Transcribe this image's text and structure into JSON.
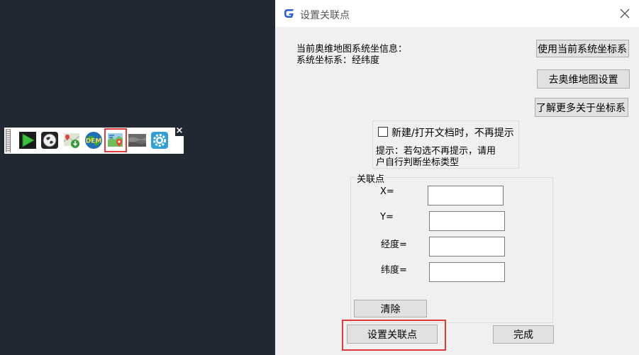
{
  "toolbar": {
    "close_label": "×",
    "buttons": [
      {
        "icon": "play-arrow-icon"
      },
      {
        "icon": "globe-icon"
      },
      {
        "icon": "map-download-icon"
      },
      {
        "icon": "dem-globe-icon"
      },
      {
        "icon": "map-pin-icon",
        "selected": true
      },
      {
        "icon": "terrain-layer-icon"
      },
      {
        "icon": "settings-gear-icon"
      }
    ],
    "dem_text": "DEM"
  },
  "dialog": {
    "title": "设置关联点",
    "info_line1": "当前奥维地图系统坐信息：",
    "info_line2": "系统坐标系：经纬度",
    "btn_use_current": "使用当前系统坐标系",
    "btn_goto_settings": "去奥维地图设置",
    "btn_learn_more": "了解更多关于坐标系",
    "checkbox_label": "新建/打开文档时，不再提示",
    "hint_line1": "提示：若勾选不再提示，请用",
    "hint_line2": "户自行判断坐标类型",
    "group_title": "关联点",
    "field_x_label": "X=",
    "field_y_label": "Y=",
    "field_lon_label": "经度=",
    "field_lat_label": "纬度=",
    "field_x_value": "",
    "field_y_value": "",
    "field_lon_value": "",
    "field_lat_value": "",
    "btn_clear": "清除",
    "btn_set_point": "设置关联点",
    "btn_done": "完成"
  },
  "colors": {
    "background": "#222831",
    "dialog_bg": "#f0f0f0",
    "highlight": "#e03a3a",
    "logo_blue": "#2b5fd9"
  }
}
